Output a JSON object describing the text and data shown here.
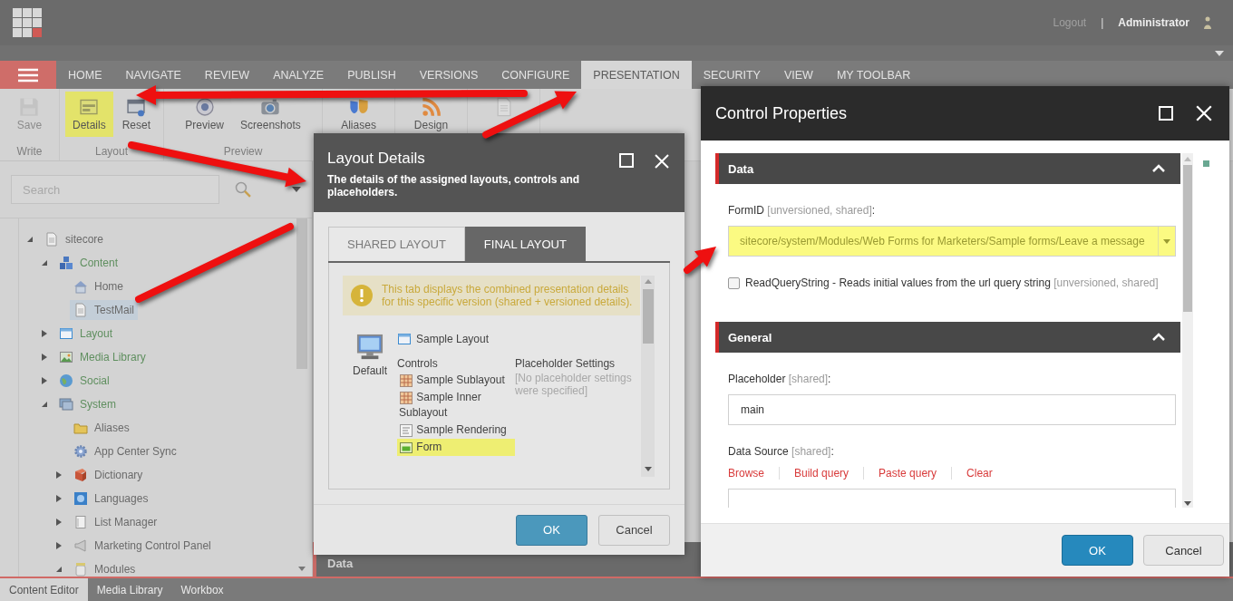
{
  "header": {
    "logout": "Logout",
    "separator": "|",
    "user": "Administrator"
  },
  "ribbon_tabs": [
    {
      "label": "HOME",
      "selected": false
    },
    {
      "label": "NAVIGATE",
      "selected": false
    },
    {
      "label": "REVIEW",
      "selected": false
    },
    {
      "label": "ANALYZE",
      "selected": false
    },
    {
      "label": "PUBLISH",
      "selected": false
    },
    {
      "label": "VERSIONS",
      "selected": false
    },
    {
      "label": "CONFIGURE",
      "selected": false
    },
    {
      "label": "PRESENTATION",
      "selected": true
    },
    {
      "label": "SECURITY",
      "selected": false
    },
    {
      "label": "VIEW",
      "selected": false
    },
    {
      "label": "MY TOOLBAR",
      "selected": false
    }
  ],
  "ribbon_groups": [
    {
      "label": "Write",
      "buttons": [
        {
          "label": "Save",
          "disabled": true,
          "highlighted": false
        }
      ]
    },
    {
      "label": "Layout",
      "buttons": [
        {
          "label": "Details",
          "disabled": false,
          "highlighted": true
        },
        {
          "label": "Reset",
          "disabled": false,
          "highlighted": false
        }
      ]
    },
    {
      "label": "Preview",
      "buttons": [
        {
          "label": "Preview",
          "disabled": false,
          "highlighted": false
        },
        {
          "label": "Screenshots",
          "disabled": false,
          "highlighted": false
        }
      ]
    },
    {
      "buttons": [
        {
          "label": "Aliases",
          "disabled": false,
          "highlighted": false
        }
      ]
    },
    {
      "buttons": [
        {
          "label": "Design",
          "disabled": false,
          "highlighted": false
        }
      ]
    },
    {
      "buttons": [
        {
          "disabled": true,
          "highlighted": false
        }
      ]
    }
  ],
  "search": {
    "placeholder": "Search"
  },
  "content_tree": {
    "items": [
      {
        "label": "sitecore",
        "expanded": true,
        "selected": false,
        "color": "#6a6a6a",
        "children": [
          {
            "label": "Content",
            "expanded": true,
            "selected": false,
            "color": "#5f8f5f",
            "children": [
              {
                "label": "Home",
                "selected": false,
                "color": "#6a6a6a"
              },
              {
                "label": "TestMail",
                "selected": true,
                "color": "#6a6a6a"
              }
            ]
          },
          {
            "label": "Layout",
            "expanded": false,
            "selected": false,
            "color": "#5f8f5f"
          },
          {
            "label": "Media Library",
            "expanded": false,
            "selected": false,
            "color": "#5f8f5f"
          },
          {
            "label": "Social",
            "expanded": false,
            "selected": false,
            "color": "#5f8f5f"
          },
          {
            "label": "System",
            "expanded": true,
            "selected": false,
            "color": "#5f8f5f",
            "children": [
              {
                "label": "Aliases",
                "selected": false,
                "color": "#6a6a6a"
              },
              {
                "label": "App Center Sync",
                "selected": false,
                "color": "#6a6a6a"
              },
              {
                "label": "Dictionary",
                "expanded": false,
                "selected": false,
                "color": "#6a6a6a"
              },
              {
                "label": "Languages",
                "expanded": false,
                "selected": false,
                "color": "#6a6a6a"
              },
              {
                "label": "List Manager",
                "expanded": false,
                "selected": false,
                "color": "#6a6a6a"
              },
              {
                "label": "Marketing Control Panel",
                "expanded": false,
                "selected": false,
                "color": "#6a6a6a"
              },
              {
                "label": "Modules",
                "expanded": true,
                "selected": false,
                "color": "#6a6a6a"
              }
            ]
          }
        ]
      }
    ]
  },
  "editor": {
    "section": "Data"
  },
  "bottom_tabs": [
    {
      "label": "Content Editor",
      "selected": true
    },
    {
      "label": "Media Library",
      "selected": false
    },
    {
      "label": "Workbox",
      "selected": false
    }
  ],
  "layout_details": {
    "title": "Layout Details",
    "subtitle": "The details of the assigned layouts, controls and placeholders.",
    "tabs": [
      {
        "label": "SHARED LAYOUT",
        "selected": false
      },
      {
        "label": "FINAL LAYOUT",
        "selected": true
      }
    ],
    "notice": "This tab displays the combined presentation details for this specific version (shared + versioned details).",
    "device": "Default",
    "layout": "Sample Layout",
    "controls_heading": "Controls",
    "controls": [
      {
        "label": "Sample Sublayout",
        "highlighted": false
      },
      {
        "label": "Sample Inner Sublayout",
        "highlighted": false
      },
      {
        "label": "Sample Rendering",
        "highlighted": false
      },
      {
        "label": "Form",
        "highlighted": true
      }
    ],
    "placeholder_heading": "Placeholder Settings",
    "placeholder_note": "[No placeholder settings were specified]",
    "buttons": [
      "OK",
      "Cancel"
    ]
  },
  "control_properties": {
    "title": "Control Properties",
    "data_section": {
      "title": "Data",
      "expanded": true
    },
    "form_id": {
      "label": "FormID",
      "note": "[unversioned, shared]",
      "suffix": ":",
      "value": "sitecore/system/Modules/Web Forms for Marketers/Sample forms/Leave a message",
      "highlighted": true
    },
    "read_query_string": {
      "label": "ReadQueryString - Reads initial values from the url query string",
      "note": "[unversioned, shared]",
      "checked": false
    },
    "general_section": {
      "title": "General",
      "expanded": true
    },
    "placeholder": {
      "label": "Placeholder",
      "note": "[shared]",
      "suffix": ":",
      "value": "main"
    },
    "data_source": {
      "label": "Data Source",
      "note": "[shared]",
      "suffix": ":",
      "links": [
        "Browse",
        "Build query",
        "Paste query",
        "Clear"
      ]
    },
    "buttons": [
      "OK",
      "Cancel"
    ]
  }
}
